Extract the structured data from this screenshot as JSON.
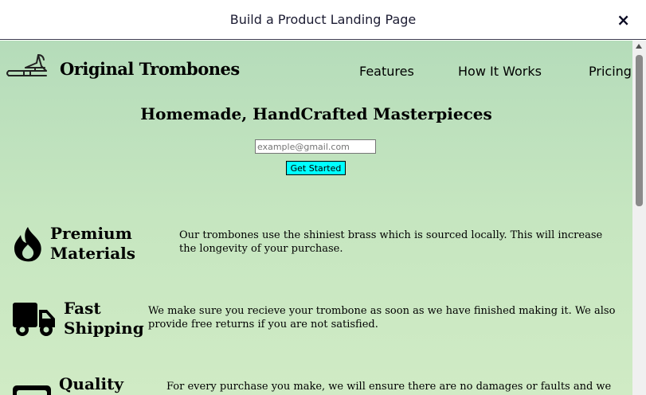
{
  "modal": {
    "title": "Build a Product Landing Page",
    "close": "×"
  },
  "header": {
    "logo": "trombone-logo",
    "brand": "Original Trombones",
    "nav": [
      "Features",
      "How It Works",
      "Pricing"
    ]
  },
  "hero": {
    "title": "Homemade, HandCrafted Masterpieces",
    "email_placeholder": "example@gmail.com",
    "button": "Get Started"
  },
  "features": [
    {
      "icon": "fire-icon",
      "title_line1": "Premium",
      "title_line2": "Materials",
      "desc": "Our trombones use the shiniest brass which is sourced locally. This will increase the longevity of your purchase."
    },
    {
      "icon": "truck-icon",
      "title_line1": "Fast",
      "title_line2": "Shipping",
      "desc": "We make sure you recieve your trombone as soon as we have finished making it. We also provide free returns if you are not satisfied."
    },
    {
      "icon": "quality-icon",
      "title_line1": "Quality",
      "title_line2": "",
      "desc": "For every purchase you make, we will ensure there are no damages or faults and we will check"
    }
  ],
  "colors": {
    "accent_button": "#00ffff",
    "bg_top": "#b5dcba",
    "bg_bottom": "#d0ebc5"
  }
}
